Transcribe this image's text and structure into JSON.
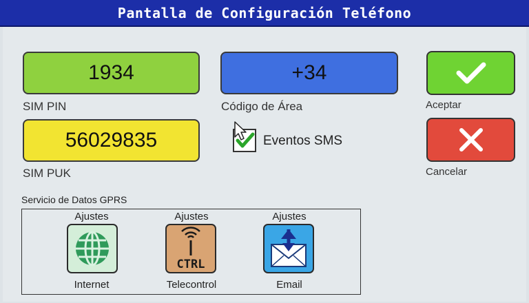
{
  "title": "Pantalla de Configuración Teléfono",
  "fields": {
    "sim_pin": {
      "value": "1934",
      "label": "SIM PIN",
      "color": "#8fd13f"
    },
    "area_code": {
      "value": "+34",
      "label": "Código de Área",
      "color": "#3f6fe0"
    },
    "sim_puk": {
      "value": "56029835",
      "label": "SIM PUK",
      "color": "#f2e431"
    }
  },
  "sms_events": {
    "label": "Eventos SMS",
    "checked": true
  },
  "actions": {
    "accept": {
      "label": "Aceptar",
      "color": "#6fd333",
      "icon": "checkmark-icon"
    },
    "cancel": {
      "label": "Cancelar",
      "color": "#e24a3c",
      "icon": "close-icon"
    }
  },
  "gprs": {
    "title": "Servicio de Datos GPRS",
    "services": [
      {
        "top_label": "Ajustes",
        "bottom_label": "Internet",
        "icon": "globe-icon"
      },
      {
        "top_label": "Ajustes",
        "bottom_label": "Telecontrol",
        "icon": "antenna-ctrl-icon",
        "icon_text": "CTRL"
      },
      {
        "top_label": "Ajustes",
        "bottom_label": "Email",
        "icon": "envelope-icon"
      }
    ]
  }
}
